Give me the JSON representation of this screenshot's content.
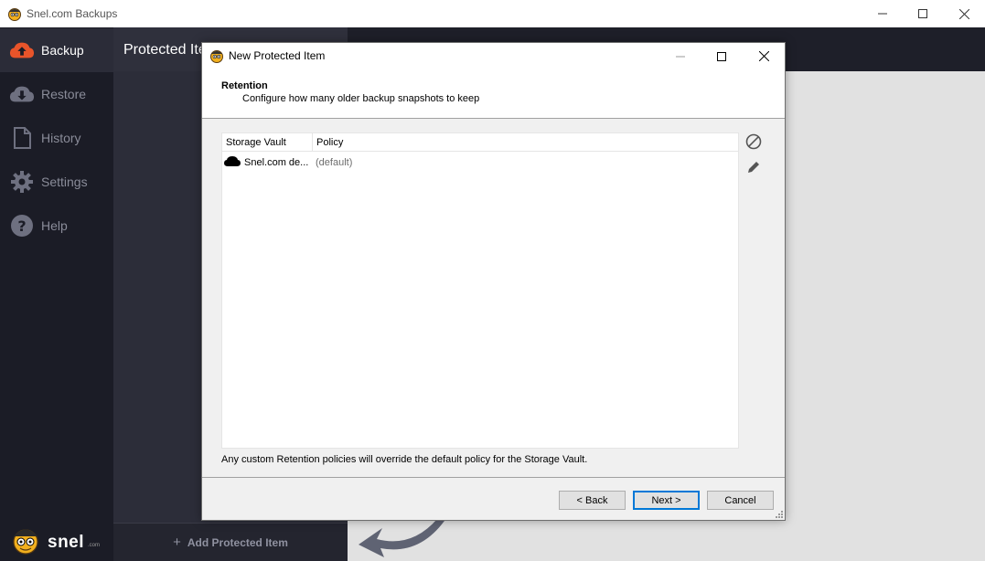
{
  "app": {
    "title": "Snel.com Backups",
    "window_controls": [
      "minimize",
      "maximize",
      "close"
    ]
  },
  "sidebar": {
    "items": [
      {
        "label": "Backup",
        "icon": "cloud-upload-icon",
        "active": true
      },
      {
        "label": "Restore",
        "icon": "cloud-download-icon",
        "active": false
      },
      {
        "label": "History",
        "icon": "document-icon",
        "active": false
      },
      {
        "label": "Settings",
        "icon": "gear-icon",
        "active": false
      },
      {
        "label": "Help",
        "icon": "help-icon",
        "active": false
      }
    ],
    "logo_text": "snel",
    "logo_small": ".com"
  },
  "panel": {
    "title": "Protected Ite",
    "add_label": "Add Protected Item"
  },
  "dialog": {
    "title": "New Protected Item",
    "header_title": "Retention",
    "header_subtitle": "Configure how many older backup snapshots to keep",
    "columns": [
      "Storage Vault",
      "Policy"
    ],
    "rows": [
      {
        "vault": "Snel.com de...",
        "policy": "(default)"
      }
    ],
    "note": "Any custom Retention policies will override the default policy for the Storage Vault.",
    "buttons": {
      "back": "< Back",
      "next": "Next >",
      "cancel": "Cancel"
    }
  },
  "colors": {
    "sidebar_bg": "#1b1c26",
    "panel_bg": "#2c2d39",
    "content_bg": "#e1e1e1",
    "accent": "#e8542a",
    "default_button_border": "#0078d7"
  }
}
